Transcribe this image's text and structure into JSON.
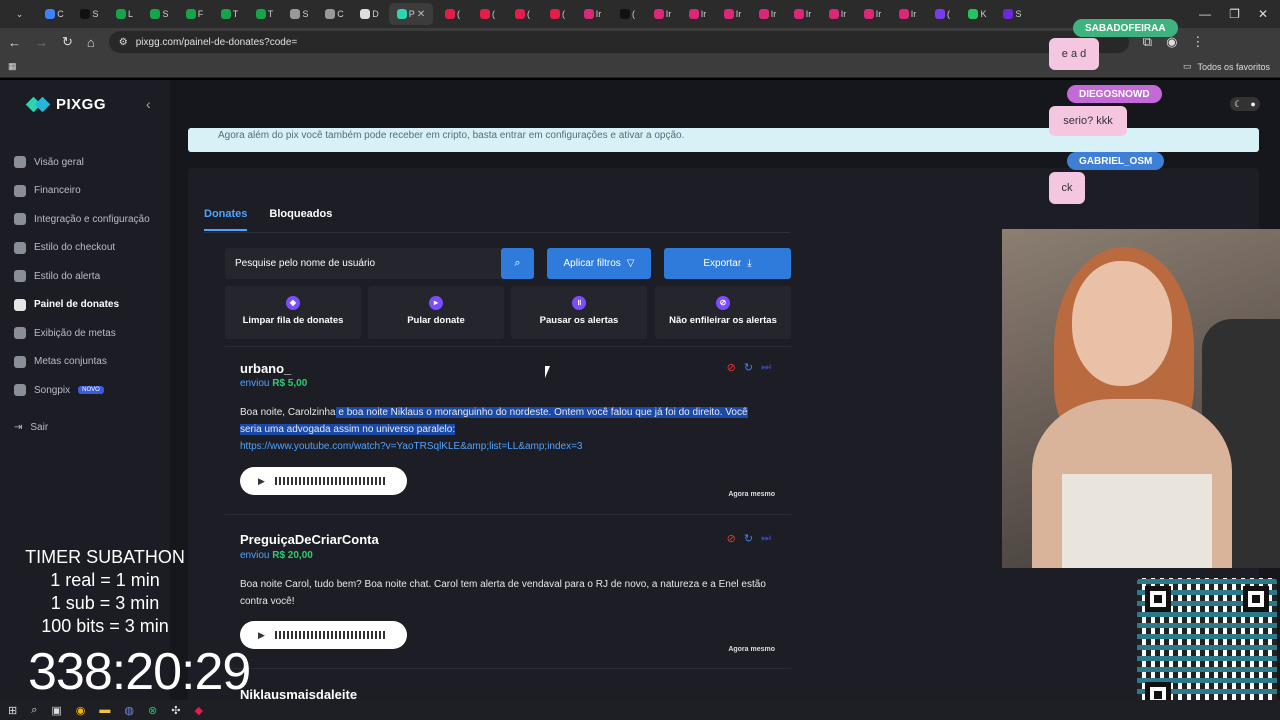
{
  "browser": {
    "url": "pixgg.com/painel-de-donates?code=",
    "active_tab": "P",
    "bookmarks_all": "Todos os favoritos"
  },
  "sidebar": {
    "logo": "PIXGG",
    "items": [
      {
        "label": "Visão geral"
      },
      {
        "label": "Financeiro"
      },
      {
        "label": "Integração e configuração"
      },
      {
        "label": "Estilo do checkout"
      },
      {
        "label": "Estilo do alerta"
      },
      {
        "label": "Painel de donates"
      },
      {
        "label": "Exibição de metas"
      },
      {
        "label": "Metas conjuntas"
      },
      {
        "label": "Songpix",
        "badge": "NOVO"
      }
    ],
    "logout": "Sair"
  },
  "info_bar": "Agora além do pix você também pode receber em cripto, basta entrar em configurações e ativar a opção.",
  "tabs": [
    "Donates",
    "Bloqueados"
  ],
  "search": {
    "placeholder": "Pesquise pelo nome de usuário"
  },
  "filters_button": "Aplicar filtros",
  "export_button": "Exportar",
  "actions": [
    {
      "label": "Limpar fila de donates",
      "icon": "eraser-icon"
    },
    {
      "label": "Pular donate",
      "icon": "skip-icon"
    },
    {
      "label": "Pausar os alertas",
      "icon": "pause-icon"
    },
    {
      "label": "Não enfileirar os alertas",
      "icon": "bell-off-icon"
    }
  ],
  "donates": [
    {
      "user": "urbano_",
      "sent_prefix": "enviou",
      "amount": "R$ 5,00",
      "message_a": "Boa noite, Carolzinha",
      "message_b": " e boa noite Niklaus o moranguinho do nordeste. Ontem você falou que já foi do direito. Você seria uma advogada assim no universo paralelo:",
      "link": "https://www.youtube.com/watch?v=YaoTRSqlKLE&amp;list=LL&amp;index=3",
      "time": "Agora mesmo"
    },
    {
      "user": "PreguiçaDeCriarConta",
      "sent_prefix": "enviou",
      "amount": "R$ 20,00",
      "message": "Boa noite Carol, tudo bem? Boa noite chat. Carol tem alerta de vendaval para o RJ de novo, a natureza e a Enel estão contra você!",
      "time": "Agora mesmo"
    },
    {
      "user": "Niklausmaisdaleite"
    }
  ],
  "overlay": {
    "chat": [
      {
        "name": "SABADOFEIRAA",
        "message": "e a d",
        "color": "#3fb37f"
      },
      {
        "name": "DIEGOSNOWD",
        "message": "serio? kkk",
        "color": "#c46ad8"
      },
      {
        "name": "GABRIEL_OSM",
        "message": "ck",
        "color": "#3f7fd6"
      }
    ],
    "timer": {
      "title": "TIMER SUBATHON",
      "lines": [
        "1 real = 1 min",
        "1 sub = 3 min",
        "100 bits = 3 min"
      ],
      "clock": "338:20:29"
    }
  }
}
